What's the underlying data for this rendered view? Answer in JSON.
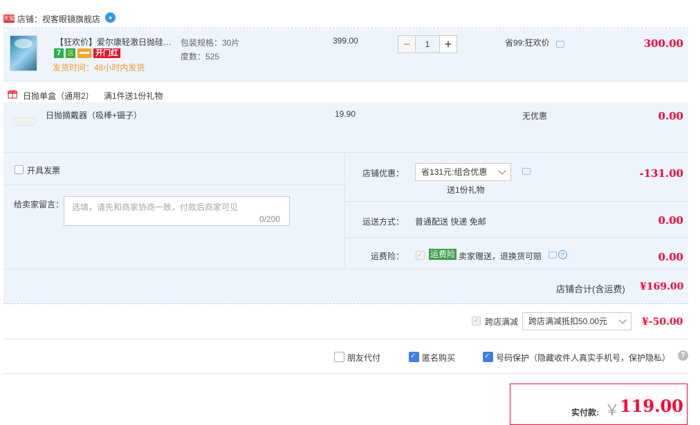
{
  "store": {
    "badge": "天猫",
    "label": "店铺：视客眼镜旗舰店",
    "ww_icon": "chat-bubble-icon"
  },
  "item": {
    "title": "【狂欢价】爱尔康轻澈日抛硅水...",
    "badges": [
      "7",
      "店",
      "card",
      "开门红"
    ],
    "ship_time": "发货时间：48小时内发货",
    "sku_spec": "包装规格：30片",
    "sku_degree": "度数：525",
    "price": "399.00",
    "quantity": "1",
    "discount": "省99:狂欢价",
    "total": "300.00"
  },
  "gift_group": {
    "label": "日抛单盒（通用2）",
    "rule": "满1件送1份礼物",
    "item_title": "日抛摘戴器（吸棒+镊子）",
    "price": "19.90",
    "discount": "无优惠",
    "total": "0.00"
  },
  "order_options": {
    "invoice_label": "开具发票",
    "message_label": "给卖家留言：",
    "message_placeholder": "选填，请先和商家协商一致，付款后商家可见",
    "message_count": "0/200",
    "store_discount_label": "店铺优惠：",
    "store_discount_value": "省131元:组合优惠",
    "store_discount_note": "送1份礼物",
    "store_discount_amount": "-131.00",
    "shipping_label": "运送方式：",
    "shipping_value": "普通配送 快递 免邮",
    "shipping_amount": "0.00",
    "insurance_label": "运费险：",
    "insurance_tag": "运费险",
    "insurance_text": "卖家赠送，退换货可赔",
    "insurance_amount": "0.00",
    "store_total_label": "店铺合计(含运费)",
    "store_total_value": "¥169.00"
  },
  "cross_store": {
    "label": "跨店满减",
    "select_value": "跨店满减抵扣50.00元",
    "amount": "¥-50.00"
  },
  "options": {
    "friend_pay": "朋友代付",
    "anonymous": "匿名购买",
    "number_protect": "号码保护（隐藏收件人真实手机号，保护隐私）"
  },
  "payment": {
    "label": "实付款:",
    "yen": "￥",
    "amount": "119.00"
  },
  "colors": {
    "accent_red": "#ff0036",
    "panel_bg": "#eef4fb",
    "check_blue": "#3d7fe6"
  }
}
